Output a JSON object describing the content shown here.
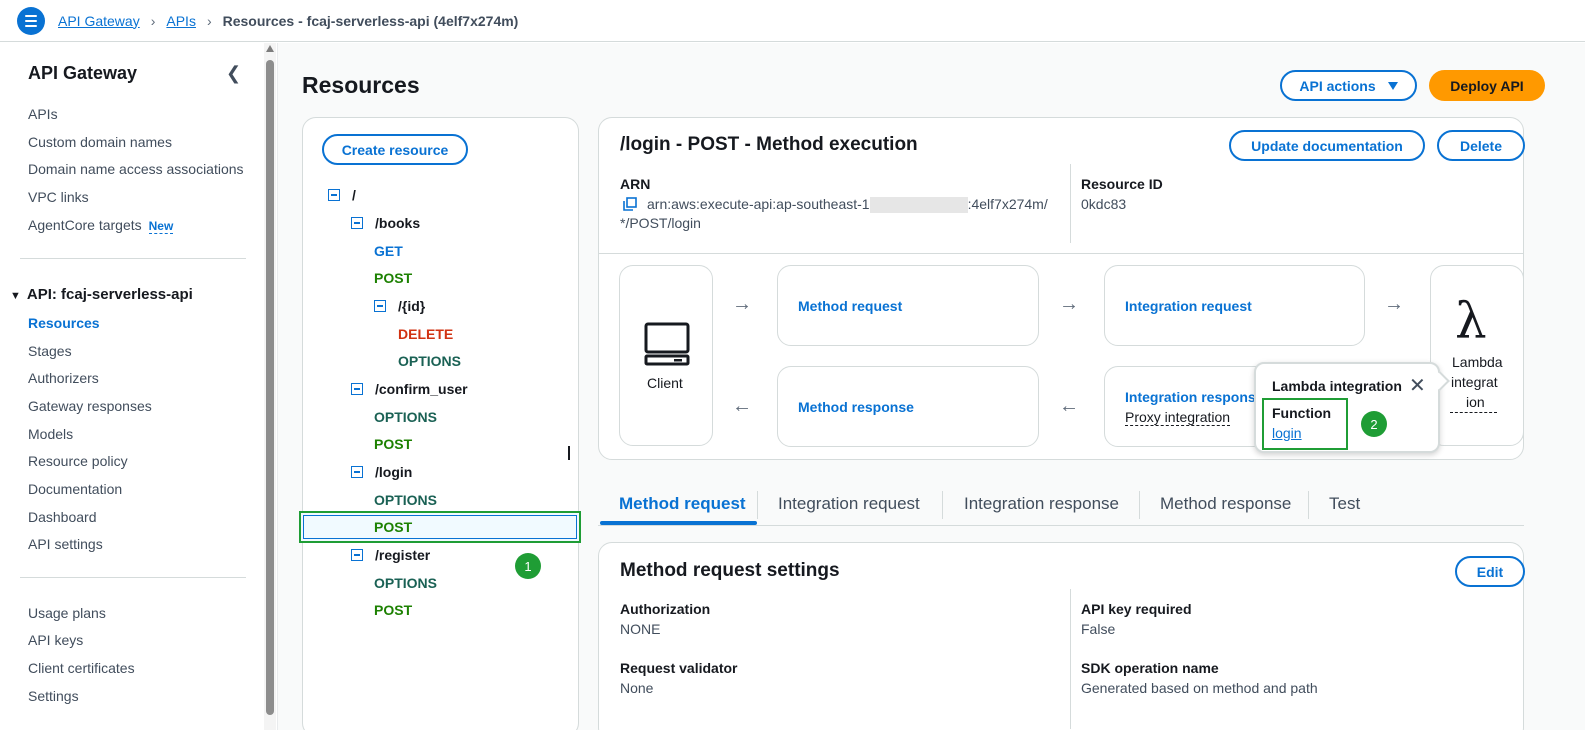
{
  "breadcrumb": {
    "items": [
      "API Gateway",
      "APIs"
    ],
    "current": "Resources - fcaj-serverless-api (4elf7x274m)"
  },
  "sidebar": {
    "title": "API Gateway",
    "top_items": [
      "APIs",
      "Custom domain names",
      "Domain name access associations",
      "VPC links",
      "AgentCore targets"
    ],
    "new_badge": "New",
    "api_section": "API: fcaj-serverless-api",
    "api_items": [
      "Resources",
      "Stages",
      "Authorizers",
      "Gateway responses",
      "Models",
      "Resource policy",
      "Documentation",
      "Dashboard",
      "API settings"
    ],
    "bottom_items": [
      "Usage plans",
      "API keys",
      "Client certificates",
      "Settings"
    ]
  },
  "page": {
    "title": "Resources",
    "api_actions_label": "API actions",
    "deploy_label": "Deploy API"
  },
  "tree": {
    "create_label": "Create resource",
    "root": "/",
    "books": "/books",
    "books_get": "GET",
    "books_post": "POST",
    "id": "/{id}",
    "id_delete": "DELETE",
    "id_options": "OPTIONS",
    "confirm_user": "/confirm_user",
    "confirm_options": "OPTIONS",
    "confirm_post": "POST",
    "login": "/login",
    "login_options": "OPTIONS",
    "login_post": "POST",
    "register": "/register",
    "register_options": "OPTIONS",
    "register_post": "POST",
    "step1": "1"
  },
  "execution": {
    "title": "/login - POST - Method execution",
    "update_doc_label": "Update documentation",
    "delete_label": "Delete",
    "arn_label": "ARN",
    "arn_prefix": "arn:aws:execute-api:ap-southeast-1",
    "arn_suffix": ":4elf7x274m/",
    "arn_line2": "*/POST/login",
    "resource_id_label": "Resource ID",
    "resource_id": "0kdc83",
    "client_label": "Client",
    "method_request": "Method request",
    "integration_request": "Integration request",
    "method_response": "Method response",
    "integration_response": "Integration respons",
    "proxy_integration": "Proxy integration",
    "lambda_label_1": "Lambda",
    "lambda_label_2": "integrat",
    "lambda_label_3": "ion"
  },
  "popover": {
    "title": "Lambda integration",
    "function_label": "Function",
    "function_value": "login",
    "step2": "2"
  },
  "tabs": [
    "Method request",
    "Integration request",
    "Integration response",
    "Method response",
    "Test"
  ],
  "settings": {
    "title": "Method request settings",
    "edit_label": "Edit",
    "authorization_label": "Authorization",
    "authorization_value": "NONE",
    "api_key_label": "API key required",
    "api_key_value": "False",
    "validator_label": "Request validator",
    "validator_value": "None",
    "sdk_label": "SDK operation name",
    "sdk_value": "Generated based on method and path"
  }
}
